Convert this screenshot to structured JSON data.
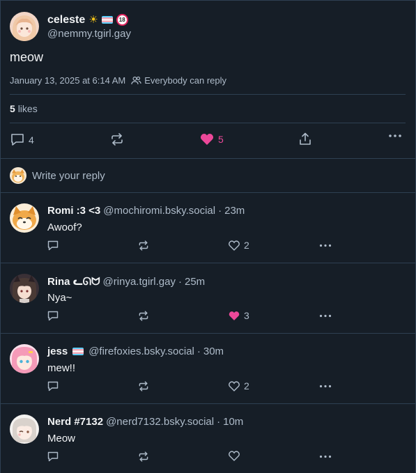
{
  "post": {
    "author": {
      "display_name": "celeste",
      "handle": "@nemmy.tgirl.gay",
      "badges": [
        "sun-emoji",
        "trans-flag-emoji",
        "no-under-18-emoji"
      ],
      "no18_text": "18"
    },
    "text": "meow",
    "timestamp": "January 13, 2025 at 6:14 AM",
    "reply_setting": "Everybody can reply",
    "likes_count": "5",
    "likes_label": "likes",
    "actions": {
      "reply_count": "4",
      "repost_count": "",
      "like_count": "5"
    }
  },
  "composer": {
    "placeholder": "Write your reply"
  },
  "replies": [
    {
      "display_name": "Romi :3 <3",
      "handle": "@mochiromi.bsky.social",
      "time": "23m",
      "text": "Awoof?",
      "like_count": "2",
      "liked": false
    },
    {
      "display_name": "Rina ᓚᘏᗢ",
      "handle": "@rinya.tgirl.gay",
      "time": "25m",
      "text": "Nya~",
      "like_count": "3",
      "liked": true
    },
    {
      "display_name": "jess",
      "handle": "@firefoxies.bsky.social",
      "time": "30m",
      "text": "mew!!",
      "like_count": "2",
      "liked": false,
      "badge": "trans-flag-emoji"
    },
    {
      "display_name": "Nerd #7132",
      "handle": "@nerd7132.bsky.social",
      "time": "10m",
      "text": "Meow",
      "like_count": "",
      "liked": false
    }
  ],
  "separator": "·",
  "colors": {
    "background": "#161e27",
    "border": "#2e4052",
    "text": "#f1f3f5",
    "muted": "#aebbc9",
    "like": "#ec4899"
  }
}
